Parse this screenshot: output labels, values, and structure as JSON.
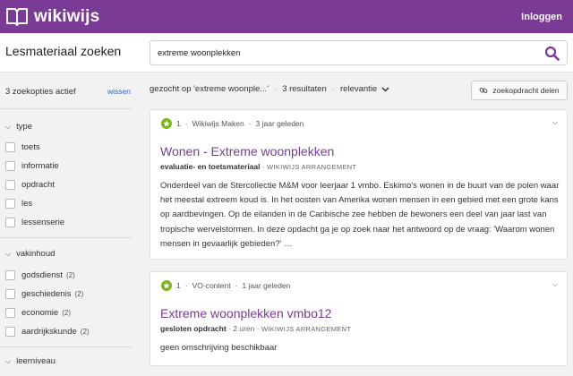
{
  "header": {
    "logo_text": "wikiwijs",
    "login_label": "Inloggen",
    "brand_color": "#7a3a96"
  },
  "search": {
    "page_title": "Lesmateriaal zoeken",
    "query": "extreme woonplekken",
    "icon": "search-icon"
  },
  "sidebar": {
    "active_filters": "3 zoekopties actief",
    "clear_label": "wissen",
    "groups": [
      {
        "title": "type",
        "options": [
          {
            "label": "toets",
            "count": ""
          },
          {
            "label": "informatie",
            "count": ""
          },
          {
            "label": "opdracht",
            "count": ""
          },
          {
            "label": "les",
            "count": ""
          },
          {
            "label": "lessenserie",
            "count": ""
          }
        ]
      },
      {
        "title": "vakinhoud",
        "options": [
          {
            "label": "godsdienst",
            "count": "(2)"
          },
          {
            "label": "geschiedenis",
            "count": "(2)"
          },
          {
            "label": "economie",
            "count": "(2)"
          },
          {
            "label": "aardrijkskunde",
            "count": "(2)"
          }
        ]
      },
      {
        "title": "leerniveau",
        "options": []
      }
    ]
  },
  "results": {
    "query_summary": "gezocht op 'extreme woonple...'",
    "count_label": "3 resultaten",
    "sort_label": "relevantie",
    "share_label": "zoekopdracht delen",
    "items": [
      {
        "rating": "1",
        "source": "Wikiwijs Maken",
        "age": "3 jaar geleden",
        "title": "Wonen - Extreme woonplekken",
        "kind": "evaluatie- en toetsmateriaal",
        "duration": "",
        "badge": "WIKIWIJS ARRANGEMENT",
        "description": "Onderdeel van de Stercollectie M&M voor leerjaar 1 vmbo. Eskimo's wonen in de buurt van de polen waar het meestal extreem koud is. In het oosten van Amerika wonen mensen in een gebied met een grote kans op aardbevingen. Op de eilanden in de Caribische zee hebben de bewoners een deel van jaar last van tropische wervelstormen. In deze opdacht ga je op zoek naar het antwoord op de vraag: 'Waarom wonen mensen in gevaarlijk gebieden?' …"
      },
      {
        "rating": "1",
        "source": "VO-content",
        "age": "1 jaar geleden",
        "title": "Extreme woonplekken vmbo12",
        "kind": "gesloten opdracht",
        "duration": "2 uren",
        "badge": "WIKIWIJS ARRANGEMENT",
        "description": "geen omschrijving beschikbaar"
      }
    ]
  }
}
